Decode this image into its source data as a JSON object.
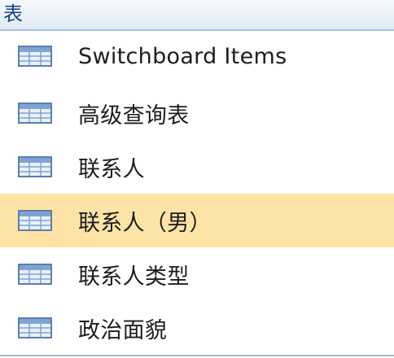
{
  "group": {
    "title": "表"
  },
  "items": [
    {
      "label": "Switchboard Items",
      "icon": "table-icon",
      "selected": false
    },
    {
      "label": "高级查询表",
      "icon": "table-icon",
      "selected": false
    },
    {
      "label": "联系人",
      "icon": "table-icon",
      "selected": false
    },
    {
      "label": "联系人（男）",
      "icon": "table-icon",
      "selected": true
    },
    {
      "label": "联系人类型",
      "icon": "table-icon",
      "selected": false
    },
    {
      "label": "政治面貌",
      "icon": "table-icon",
      "selected": false
    }
  ],
  "colors": {
    "header_text": "#15428b",
    "selected_background": "#fde4a6",
    "divider": "#a8c2df"
  }
}
